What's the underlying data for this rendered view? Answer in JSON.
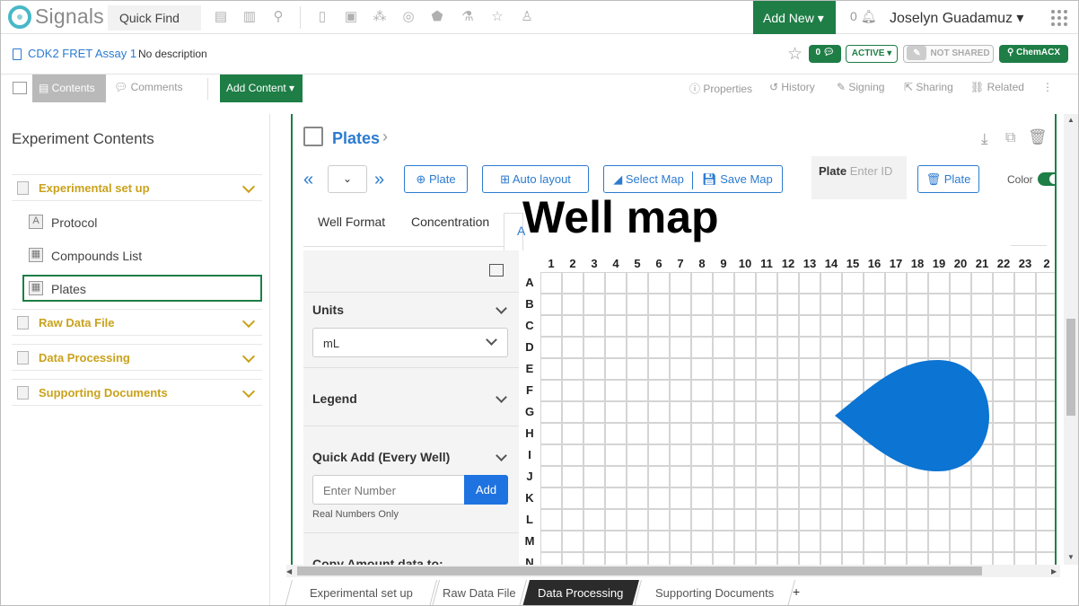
{
  "app": {
    "name": "Signals",
    "quick_find": "Quick Find",
    "add_new": "Add New",
    "notifications": "0",
    "user": "Joselyn Guadamuz"
  },
  "breadcrumb": {
    "title": "CDK2 FRET Assay 1",
    "description": "No description"
  },
  "status": {
    "comments_count": "0",
    "state": "ACTIVE",
    "sharing": "NOT SHARED",
    "chemacx": "ChemACX"
  },
  "toolbar": {
    "contents": "Contents",
    "comments": "Comments",
    "add_content": "Add Content",
    "properties": "Properties",
    "history": "History",
    "signing": "Signing",
    "sharing": "Sharing",
    "related": "Related"
  },
  "left_panel": {
    "title": "Experiment Contents",
    "sections": [
      {
        "label": "Experimental set up",
        "children": [
          {
            "label": "Protocol"
          },
          {
            "label": "Compounds List"
          },
          {
            "label": "Plates"
          }
        ]
      },
      {
        "label": "Raw Data File"
      },
      {
        "label": "Data Processing"
      },
      {
        "label": "Supporting Documents"
      }
    ]
  },
  "main": {
    "title": "Plates",
    "plate_btn": "Plate",
    "auto_layout": "Auto layout",
    "select_map": "Select Map",
    "save_map": "Save Map",
    "plate_label": "Plate",
    "plate_id_placeholder": "Enter ID",
    "delete_plate": "Plate",
    "color_label": "Color",
    "tabs": [
      {
        "label": "Well Format"
      },
      {
        "label": "Concentration"
      },
      {
        "label": "A"
      }
    ],
    "overlay_title": "Well map",
    "settings": {
      "units_label": "Units",
      "units_value": "mL",
      "legend_label": "Legend",
      "quick_add_label": "Quick Add (Every Well)",
      "number_placeholder": "Enter Number",
      "add_btn": "Add",
      "hint": "Real Numbers Only",
      "copy_label": "Copy Amount data to:"
    },
    "columns": [
      "1",
      "2",
      "3",
      "4",
      "5",
      "6",
      "7",
      "8",
      "9",
      "10",
      "11",
      "12",
      "13",
      "14",
      "15",
      "16",
      "17",
      "18",
      "19",
      "20",
      "21",
      "22",
      "23",
      "2"
    ],
    "rows": [
      "A",
      "B",
      "C",
      "D",
      "E",
      "F",
      "G",
      "H",
      "I",
      "J",
      "K",
      "L",
      "M",
      "N"
    ]
  },
  "bottom_tabs": [
    {
      "label": "Experimental set up"
    },
    {
      "label": "Raw Data File"
    },
    {
      "label": "Data Processing"
    },
    {
      "label": "Supporting Documents"
    }
  ],
  "colors": {
    "accent_green": "#1e7e46",
    "link_blue": "#2c7bd0",
    "section_gold": "#c9a21c",
    "drop_blue": "#0c74d2"
  }
}
